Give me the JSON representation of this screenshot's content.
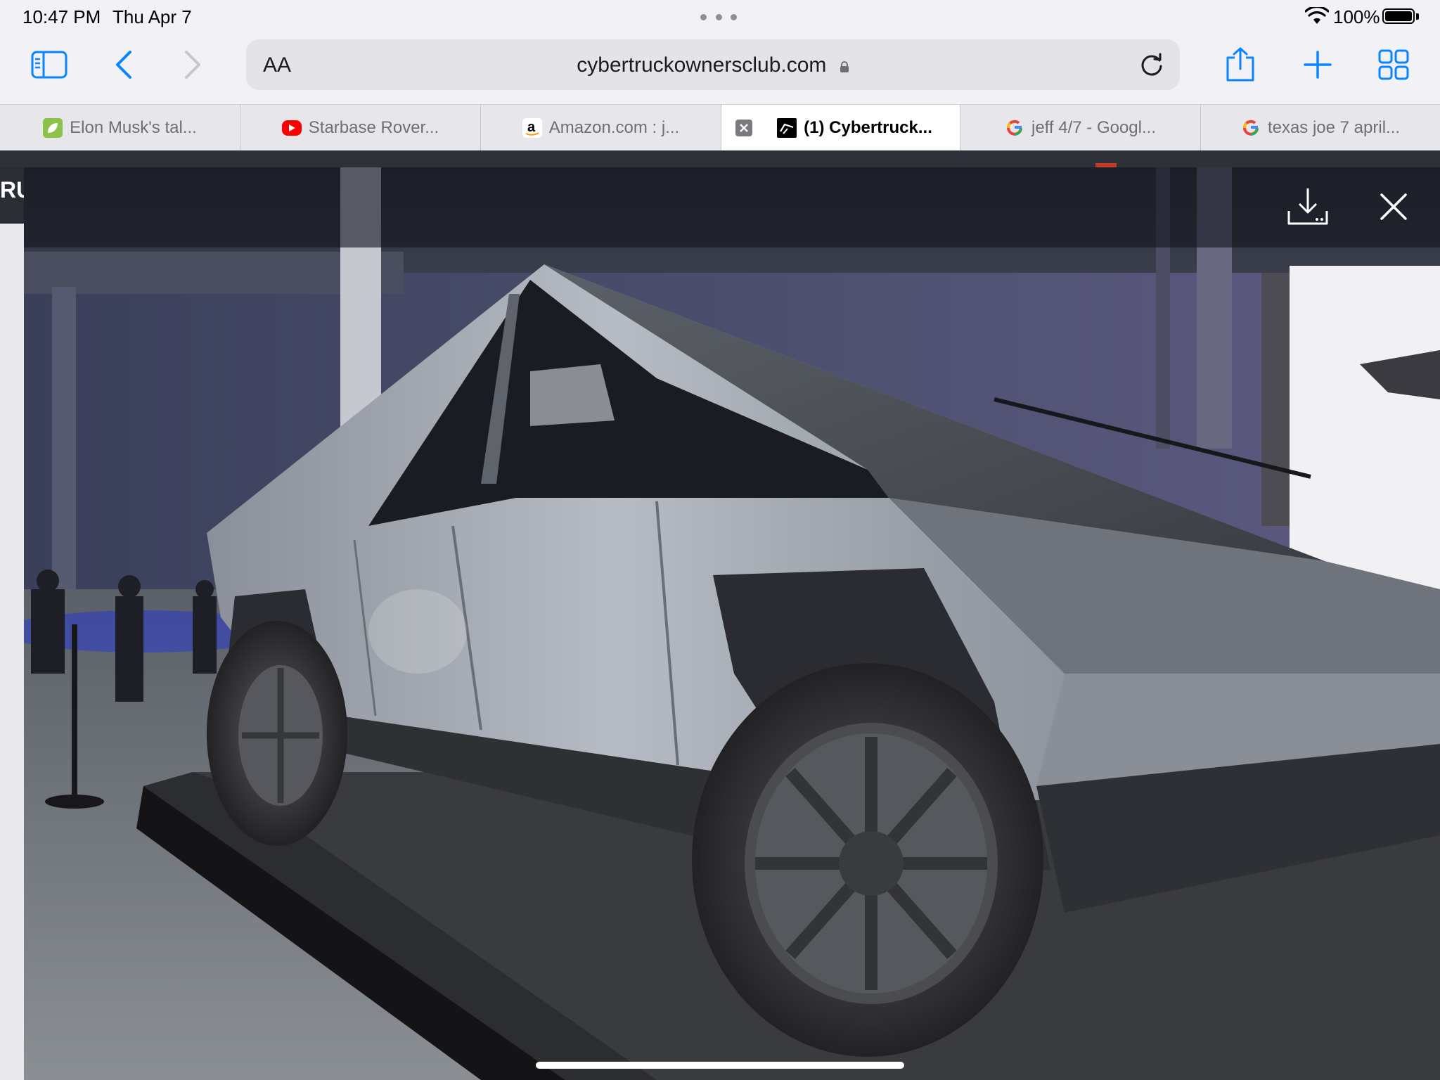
{
  "status_bar": {
    "time": "10:47 PM",
    "date": "Thu Apr 7",
    "battery": "100%",
    "battery_level": 1.0
  },
  "toolbar": {
    "reader_label": "AA",
    "url": "cybertruckownersclub.com",
    "icons": [
      "sidebar-icon",
      "back-icon",
      "forward-icon",
      "lock-icon",
      "reload-icon",
      "share-icon",
      "new-tab-icon",
      "tab-overview-icon"
    ]
  },
  "tabs": [
    {
      "title": "Elon Musk's tal...",
      "favicon": "leaf-favicon",
      "color": "#8bc34a",
      "active": false
    },
    {
      "title": "Starbase Rover...",
      "favicon": "youtube-favicon",
      "color": "#ff0000",
      "active": false
    },
    {
      "title": "Amazon.com : j...",
      "favicon": "amazon-favicon",
      "color": "#000000",
      "active": false
    },
    {
      "title": "(1) Cybertruck...",
      "favicon": "cybertruck-favicon",
      "color": "#000000",
      "active": true
    },
    {
      "title": "jeff 4/7 - Googl...",
      "favicon": "google-favicon",
      "color": "#4285f4",
      "active": false
    },
    {
      "title": "texas joe 7 april...",
      "favicon": "google-favicon",
      "color": "#4285f4",
      "active": false
    }
  ],
  "page": {
    "logo_fragment": "RU"
  },
  "lightbox": {
    "icons": [
      "download-icon",
      "close-icon"
    ]
  },
  "colors": {
    "chrome_bg": "#f2f2f6",
    "url_bar_bg": "#e3e3e8",
    "accent_blue": "#0a84ff",
    "overlay": "#14161e"
  }
}
